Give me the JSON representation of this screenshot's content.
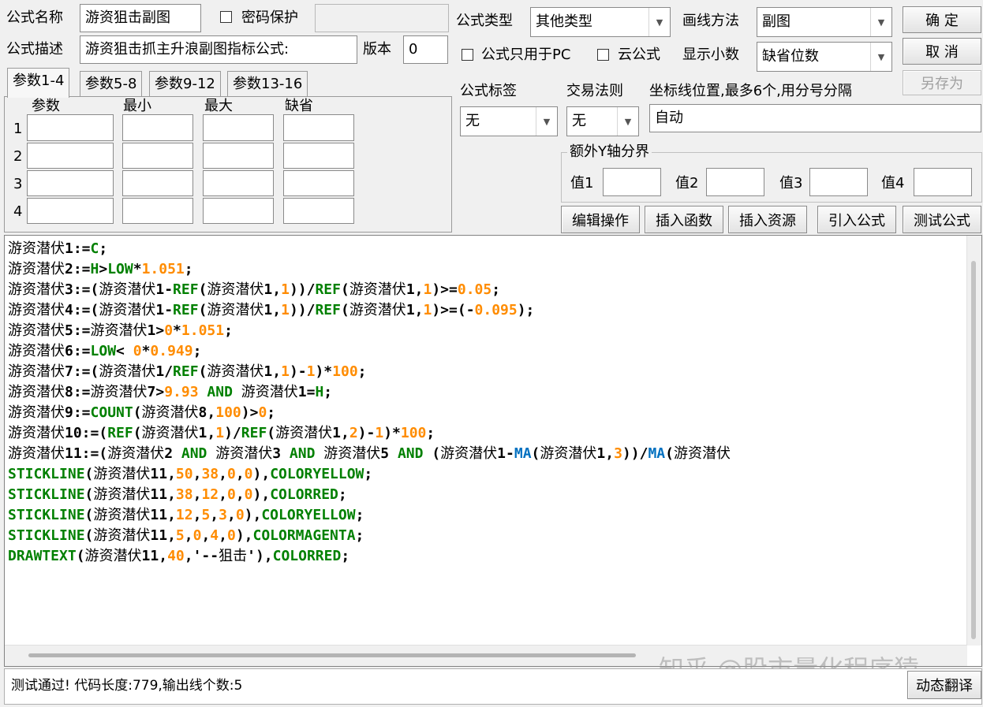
{
  "header": {
    "name_label": "公式名称",
    "name_value": "游资狙击副图",
    "password_label": "密码保护",
    "desc_label": "公式描述",
    "desc_value": "游资狙击抓主升浪副图指标公式:",
    "version_label": "版本",
    "version_value": "0",
    "type_label": "公式类型",
    "type_value": "其他类型",
    "draw_label": "画线方法",
    "draw_value": "副图",
    "pc_only_label": "公式只用于PC",
    "cloud_label": "云公式",
    "decimal_label": "显示小数",
    "decimal_value": "缺省位数"
  },
  "buttons": {
    "ok": "确  定",
    "cancel": "取  消",
    "save_as": "另存为",
    "edit_ops": "编辑操作",
    "insert_func": "插入函数",
    "insert_res": "插入资源",
    "import_formula": "引入公式",
    "test_formula": "测试公式",
    "dynamic_translate": "动态翻译"
  },
  "tabs": [
    "参数1-4",
    "参数5-8",
    "参数9-12",
    "参数13-16"
  ],
  "params": {
    "col_headers": [
      "参数",
      "最小",
      "最大",
      "缺省"
    ],
    "rows": [
      "1",
      "2",
      "3",
      "4"
    ]
  },
  "options": {
    "tag_label": "公式标签",
    "tag_value": "无",
    "trade_label": "交易法则",
    "trade_value": "无",
    "axis_label": "坐标线位置,最多6个,用分号分隔",
    "axis_value": "自动",
    "extra_y_label": "额外Y轴分界",
    "v1": "值1",
    "v2": "值2",
    "v3": "值3",
    "v4": "值4"
  },
  "code_lines": [
    [
      [
        "cn",
        "游资潜伏"
      ],
      [
        "p",
        "1:="
      ],
      [
        "k",
        "C"
      ],
      [
        "p",
        ";"
      ]
    ],
    [
      [
        "cn",
        "游资潜伏"
      ],
      [
        "p",
        "2:="
      ],
      [
        "k",
        "H"
      ],
      [
        "p",
        ">"
      ],
      [
        "k",
        "LOW"
      ],
      [
        "p",
        "*"
      ],
      [
        "n",
        "1.051"
      ],
      [
        "p",
        ";"
      ]
    ],
    [
      [
        "cn",
        "游资潜伏"
      ],
      [
        "p",
        "3:=("
      ],
      [
        "cn",
        "游资潜伏"
      ],
      [
        "p",
        "1-"
      ],
      [
        "k",
        "REF"
      ],
      [
        "p",
        "("
      ],
      [
        "cn",
        "游资潜伏"
      ],
      [
        "p",
        "1,"
      ],
      [
        "n",
        "1"
      ],
      [
        "p",
        "))/"
      ],
      [
        "k",
        "REF"
      ],
      [
        "p",
        "("
      ],
      [
        "cn",
        "游资潜伏"
      ],
      [
        "p",
        "1,"
      ],
      [
        "n",
        "1"
      ],
      [
        "p",
        ")>="
      ],
      [
        "n",
        "0.05"
      ],
      [
        "p",
        ";"
      ]
    ],
    [
      [
        "cn",
        "游资潜伏"
      ],
      [
        "p",
        "4:=("
      ],
      [
        "cn",
        "游资潜伏"
      ],
      [
        "p",
        "1-"
      ],
      [
        "k",
        "REF"
      ],
      [
        "p",
        "("
      ],
      [
        "cn",
        "游资潜伏"
      ],
      [
        "p",
        "1,"
      ],
      [
        "n",
        "1"
      ],
      [
        "p",
        "))/"
      ],
      [
        "k",
        "REF"
      ],
      [
        "p",
        "("
      ],
      [
        "cn",
        "游资潜伏"
      ],
      [
        "p",
        "1,"
      ],
      [
        "n",
        "1"
      ],
      [
        "p",
        ")>=(-"
      ],
      [
        "n",
        "0.095"
      ],
      [
        "p",
        ");"
      ]
    ],
    [
      [
        "cn",
        "游资潜伏"
      ],
      [
        "p",
        "5:="
      ],
      [
        "cn",
        "游资潜伏"
      ],
      [
        "p",
        "1>"
      ],
      [
        "n",
        "0"
      ],
      [
        "p",
        "*"
      ],
      [
        "n",
        "1.051"
      ],
      [
        "p",
        ";"
      ]
    ],
    [
      [
        "cn",
        "游资潜伏"
      ],
      [
        "p",
        "6:="
      ],
      [
        "k",
        "LOW"
      ],
      [
        "p",
        "< "
      ],
      [
        "n",
        "0"
      ],
      [
        "p",
        "*"
      ],
      [
        "n",
        "0.949"
      ],
      [
        "p",
        ";"
      ]
    ],
    [
      [
        "cn",
        "游资潜伏"
      ],
      [
        "p",
        "7:=("
      ],
      [
        "cn",
        "游资潜伏"
      ],
      [
        "p",
        "1/"
      ],
      [
        "k",
        "REF"
      ],
      [
        "p",
        "("
      ],
      [
        "cn",
        "游资潜伏"
      ],
      [
        "p",
        "1,"
      ],
      [
        "n",
        "1"
      ],
      [
        "p",
        ")-"
      ],
      [
        "n",
        "1"
      ],
      [
        "p",
        ")*"
      ],
      [
        "n",
        "100"
      ],
      [
        "p",
        ";"
      ]
    ],
    [
      [
        "cn",
        "游资潜伏"
      ],
      [
        "p",
        "8:="
      ],
      [
        "cn",
        "游资潜伏"
      ],
      [
        "p",
        "7>"
      ],
      [
        "n",
        "9.93"
      ],
      [
        "p",
        " "
      ],
      [
        "k",
        "AND"
      ],
      [
        "p",
        " "
      ],
      [
        "cn",
        "游资潜伏"
      ],
      [
        "p",
        "1="
      ],
      [
        "k",
        "H"
      ],
      [
        "p",
        ";"
      ]
    ],
    [
      [
        "cn",
        "游资潜伏"
      ],
      [
        "p",
        "9:="
      ],
      [
        "k",
        "COUNT"
      ],
      [
        "p",
        "("
      ],
      [
        "cn",
        "游资潜伏"
      ],
      [
        "p",
        "8,"
      ],
      [
        "n",
        "100"
      ],
      [
        "p",
        ")>"
      ],
      [
        "n",
        "0"
      ],
      [
        "p",
        ";"
      ]
    ],
    [
      [
        "cn",
        "游资潜伏"
      ],
      [
        "p",
        "10:=("
      ],
      [
        "k",
        "REF"
      ],
      [
        "p",
        "("
      ],
      [
        "cn",
        "游资潜伏"
      ],
      [
        "p",
        "1,"
      ],
      [
        "n",
        "1"
      ],
      [
        "p",
        ")/"
      ],
      [
        "k",
        "REF"
      ],
      [
        "p",
        "("
      ],
      [
        "cn",
        "游资潜伏"
      ],
      [
        "p",
        "1,"
      ],
      [
        "n",
        "2"
      ],
      [
        "p",
        ")-"
      ],
      [
        "n",
        "1"
      ],
      [
        "p",
        ")*"
      ],
      [
        "n",
        "100"
      ],
      [
        "p",
        ";"
      ]
    ],
    [
      [
        "cn",
        "游资潜伏"
      ],
      [
        "p",
        "11:=("
      ],
      [
        "cn",
        "游资潜伏"
      ],
      [
        "p",
        "2 "
      ],
      [
        "k",
        "AND"
      ],
      [
        "p",
        " "
      ],
      [
        "cn",
        "游资潜伏"
      ],
      [
        "p",
        "3 "
      ],
      [
        "k",
        "AND"
      ],
      [
        "p",
        " "
      ],
      [
        "cn",
        "游资潜伏"
      ],
      [
        "p",
        "5 "
      ],
      [
        "k",
        "AND"
      ],
      [
        "p",
        " ("
      ],
      [
        "cn",
        "游资潜伏"
      ],
      [
        "p",
        "1-"
      ],
      [
        "m",
        "MA"
      ],
      [
        "p",
        "("
      ],
      [
        "cn",
        "游资潜伏"
      ],
      [
        "p",
        "1,"
      ],
      [
        "n",
        "3"
      ],
      [
        "p",
        "))/"
      ],
      [
        "m",
        "MA"
      ],
      [
        "p",
        "("
      ],
      [
        "cn",
        "游资潜伏"
      ]
    ],
    [
      [
        "k",
        "STICKLINE"
      ],
      [
        "p",
        "("
      ],
      [
        "cn",
        "游资潜伏"
      ],
      [
        "p",
        "11,"
      ],
      [
        "n",
        "50"
      ],
      [
        "p",
        ","
      ],
      [
        "n",
        "38"
      ],
      [
        "p",
        ","
      ],
      [
        "n",
        "0"
      ],
      [
        "p",
        ","
      ],
      [
        "n",
        "0"
      ],
      [
        "p",
        "),"
      ],
      [
        "k",
        "COLORYELLOW"
      ],
      [
        "p",
        ";"
      ]
    ],
    [
      [
        "k",
        "STICKLINE"
      ],
      [
        "p",
        "("
      ],
      [
        "cn",
        "游资潜伏"
      ],
      [
        "p",
        "11,"
      ],
      [
        "n",
        "38"
      ],
      [
        "p",
        ","
      ],
      [
        "n",
        "12"
      ],
      [
        "p",
        ","
      ],
      [
        "n",
        "0"
      ],
      [
        "p",
        ","
      ],
      [
        "n",
        "0"
      ],
      [
        "p",
        "),"
      ],
      [
        "k",
        "COLORRED"
      ],
      [
        "p",
        ";"
      ]
    ],
    [
      [
        "k",
        "STICKLINE"
      ],
      [
        "p",
        "("
      ],
      [
        "cn",
        "游资潜伏"
      ],
      [
        "p",
        "11,"
      ],
      [
        "n",
        "12"
      ],
      [
        "p",
        ","
      ],
      [
        "n",
        "5"
      ],
      [
        "p",
        ","
      ],
      [
        "n",
        "3"
      ],
      [
        "p",
        ","
      ],
      [
        "n",
        "0"
      ],
      [
        "p",
        "),"
      ],
      [
        "k",
        "COLORYELLOW"
      ],
      [
        "p",
        ";"
      ]
    ],
    [
      [
        "k",
        "STICKLINE"
      ],
      [
        "p",
        "("
      ],
      [
        "cn",
        "游资潜伏"
      ],
      [
        "p",
        "11,"
      ],
      [
        "n",
        "5"
      ],
      [
        "p",
        ","
      ],
      [
        "n",
        "0"
      ],
      [
        "p",
        ","
      ],
      [
        "n",
        "4"
      ],
      [
        "p",
        ","
      ],
      [
        "n",
        "0"
      ],
      [
        "p",
        "),"
      ],
      [
        "k",
        "COLORMAGENTA"
      ],
      [
        "p",
        ";"
      ]
    ],
    [
      [
        "k",
        "DRAWTEXT"
      ],
      [
        "p",
        "("
      ],
      [
        "cn",
        "游资潜伏"
      ],
      [
        "p",
        "11,"
      ],
      [
        "n",
        "40"
      ],
      [
        "p",
        ",'--"
      ],
      [
        "cn",
        "狙击"
      ],
      [
        "p",
        "'),"
      ],
      [
        "k",
        "COLORRED"
      ],
      [
        "p",
        ";"
      ]
    ]
  ],
  "status_text": "测试通过! 代码长度:779,输出线个数:5",
  "watermark": "知乎 @股市量化程序猿",
  "colors": {
    "keyword": "#008000",
    "number": "#ff8c00",
    "ma": "#0070c0"
  }
}
